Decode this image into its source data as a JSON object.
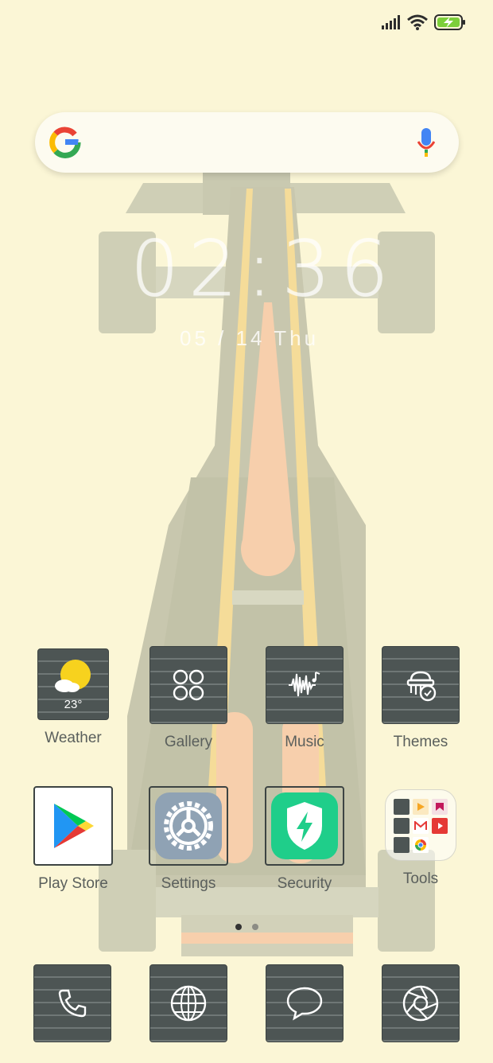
{
  "status_bar": {
    "icons": [
      "signal-icon",
      "wifi-icon",
      "battery-charging-icon"
    ],
    "battery_color": "#7ccf3a"
  },
  "search": {
    "logo": "google-logo",
    "mic": "microphone-icon"
  },
  "clock": {
    "time": "02:36",
    "date": "05 / 14  Thu"
  },
  "apps_row1": [
    {
      "label": "Weather",
      "icon": "weather-icon",
      "temp": "23°"
    },
    {
      "label": "Gallery",
      "icon": "gallery-icon"
    },
    {
      "label": "Music",
      "icon": "music-icon"
    },
    {
      "label": "Themes",
      "icon": "themes-icon"
    }
  ],
  "apps_row2": [
    {
      "label": "Play Store",
      "icon": "play-store-icon"
    },
    {
      "label": "Settings",
      "icon": "settings-icon"
    },
    {
      "label": "Security",
      "icon": "security-icon"
    },
    {
      "label": "Tools",
      "icon": "tools-folder-icon"
    }
  ],
  "page_indicator": {
    "count": 2,
    "active": 1
  },
  "dock": [
    {
      "icon": "phone-icon"
    },
    {
      "icon": "browser-icon"
    },
    {
      "icon": "messages-icon"
    },
    {
      "icon": "camera-icon"
    }
  ],
  "colors": {
    "background": "#fbf6d6",
    "tile_dark": "#4d5554",
    "security_green": "#1fce8a",
    "accent_weather": "#f7d21e"
  }
}
